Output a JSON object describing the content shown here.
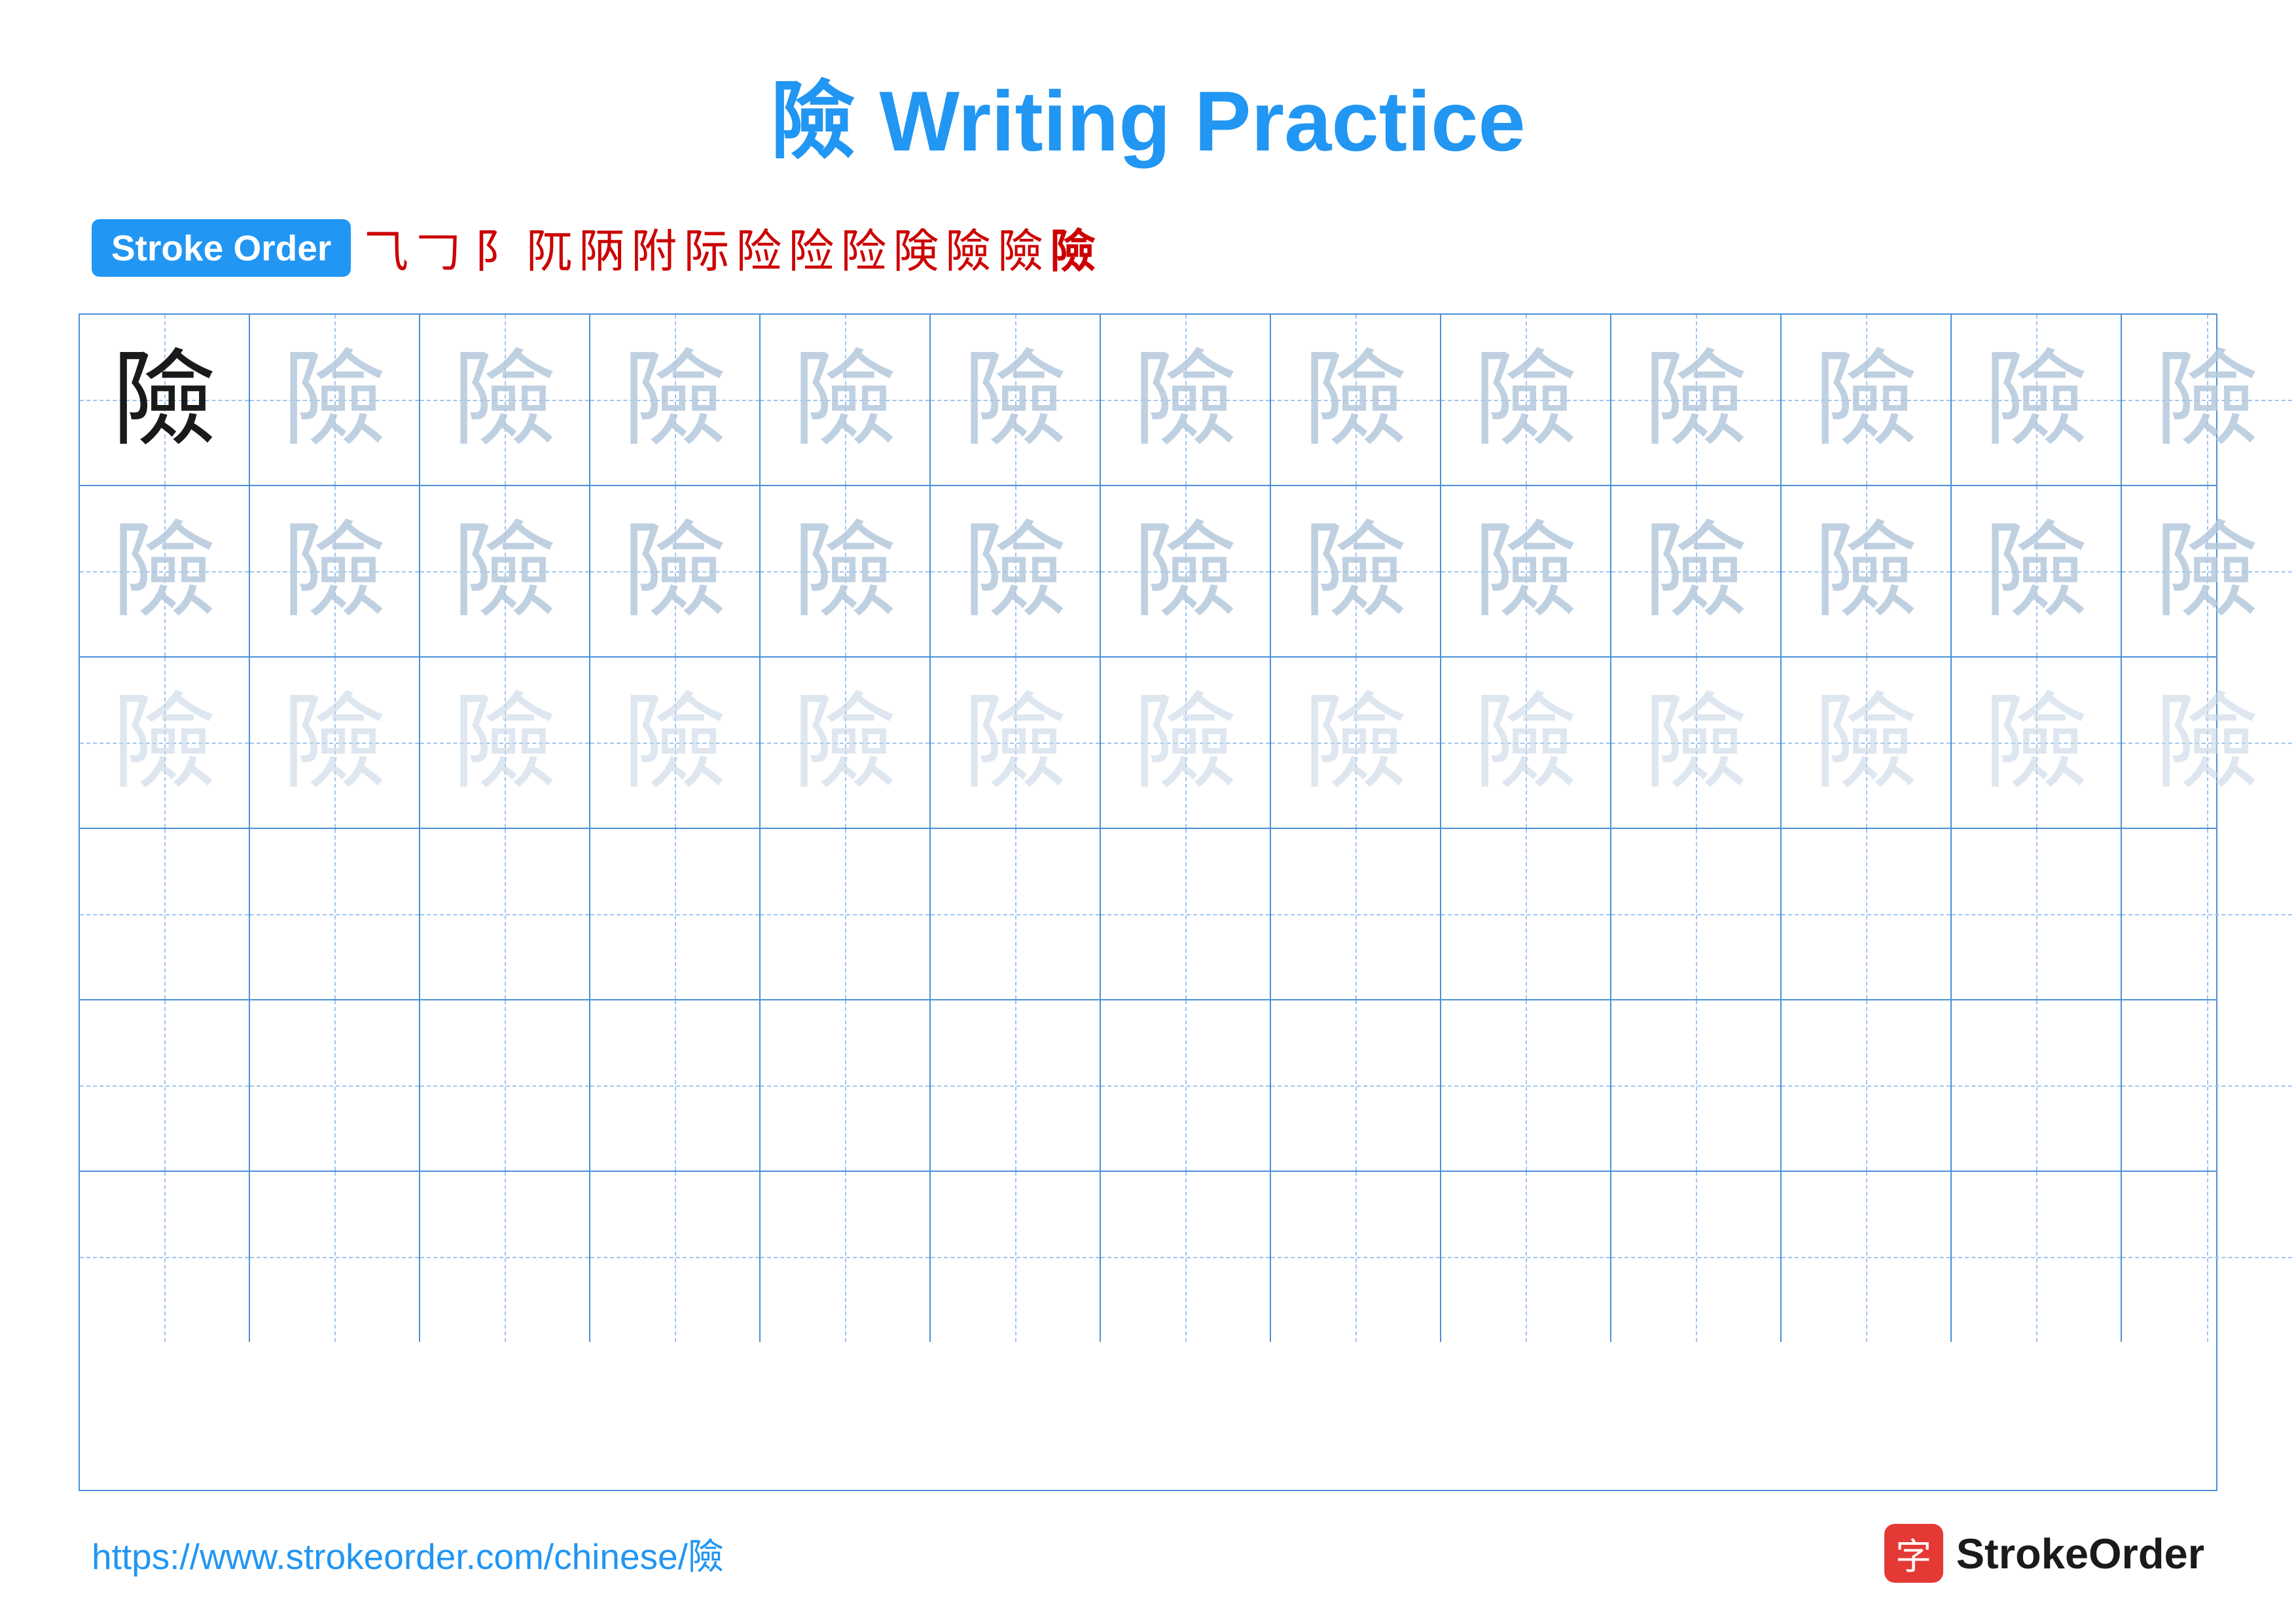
{
  "title": "險 Writing Practice",
  "stroke_order": {
    "label": "Stroke Order",
    "steps": [
      "⺄",
      "ᒐ",
      "ᒑ",
      "阝",
      "阢",
      "阣",
      "阤",
      "阥",
      "阦",
      "阧",
      "阨",
      "阩",
      "阪",
      "阫",
      "險"
    ]
  },
  "character": "險",
  "rows": [
    {
      "type": "dark_then_medium",
      "dark_count": 1,
      "medium_count": 12
    },
    {
      "type": "medium",
      "count": 13
    },
    {
      "type": "light",
      "count": 13
    },
    {
      "type": "empty",
      "count": 13
    },
    {
      "type": "empty",
      "count": 13
    },
    {
      "type": "empty",
      "count": 13
    }
  ],
  "footer": {
    "url": "https://www.strokeorder.com/chinese/險",
    "logo_text": "StrokeOrder",
    "logo_icon": "字"
  }
}
